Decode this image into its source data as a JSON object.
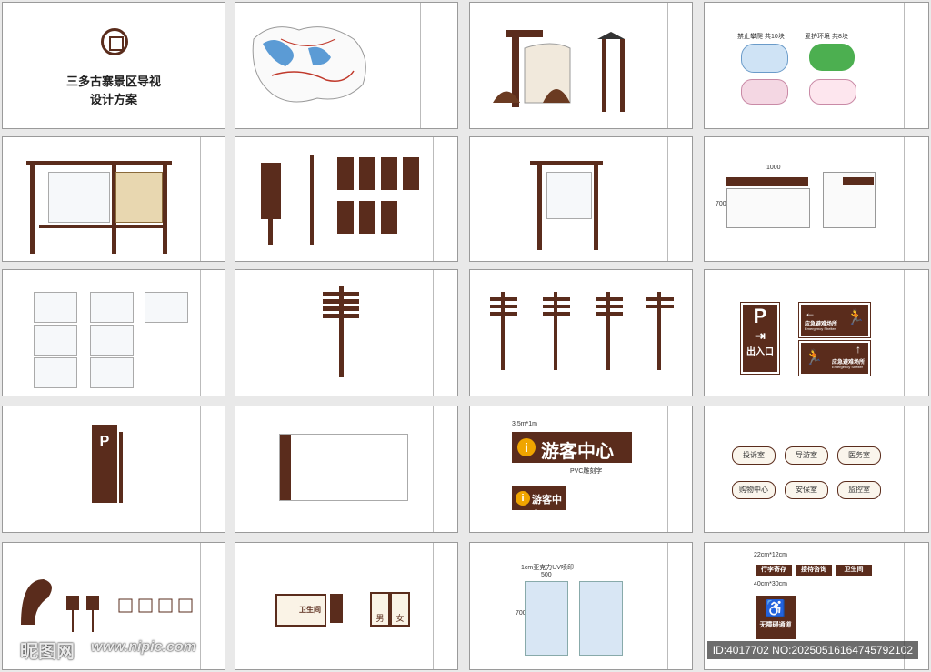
{
  "cover": {
    "title_line1": "三多古寨景区导视",
    "title_line2": "设计方案"
  },
  "visitor_center": {
    "big_label": "游客中心",
    "small_label": "游客中心",
    "size_note": "3.5m*1m",
    "small_note": "PVC雕刻字"
  },
  "parking_sheet": {
    "parking_icon": "P",
    "entrance_label": "出入口",
    "shelter_label_1": "应急避难场所",
    "shelter_label_1_en": "Emergency Shelter",
    "shelter_label_2": "应急避难场所",
    "shelter_label_2_en": "Emergency Shelter"
  },
  "service_tags": {
    "items": [
      "投诉室",
      "导游室",
      "医务室",
      "购物中心",
      "安保室",
      "监控室"
    ]
  },
  "toilet_sheet": {
    "toilet_label": "卫生间",
    "male_label": "男",
    "female_label": "女"
  },
  "accessible_sheet": {
    "header_note": "22cm*12cm",
    "items": [
      "行李寄存",
      "接待咨询",
      "卫生间"
    ],
    "sub_note": "40cm*30cm",
    "accessible_label": "无障碍通道"
  },
  "board_sheet": {
    "dim_width": "500",
    "dim_height": "700",
    "note": "1cm亚克力UV喷印"
  },
  "stickers": {
    "note_left": "禁止攀爬 共10块",
    "note_right": "爱护环境 共8块"
  },
  "dims": {
    "width_1000": "1000",
    "height_700": "700"
  },
  "watermark": {
    "logo_text": "昵图网",
    "url_text": "www.nipic.com"
  },
  "id_bar": {
    "text": "ID:4017702 NO:20250516164745792102"
  }
}
